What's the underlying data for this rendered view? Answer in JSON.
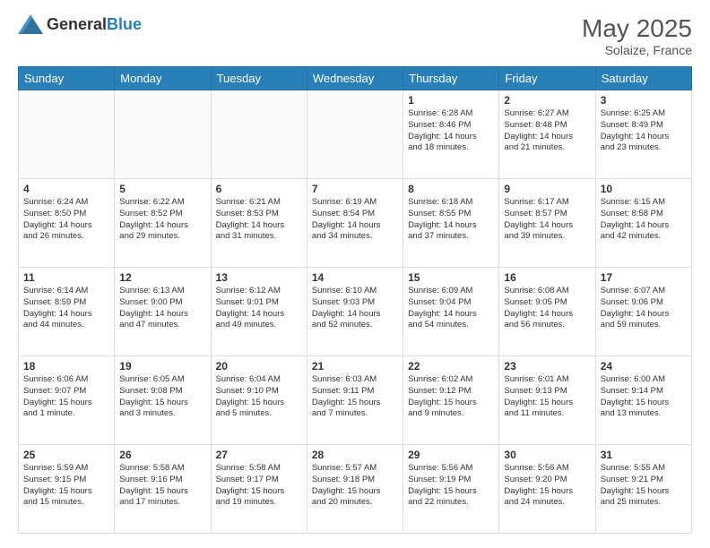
{
  "logo": {
    "text_general": "General",
    "text_blue": "Blue"
  },
  "title": {
    "month_year": "May 2025",
    "location": "Solaize, France"
  },
  "days_of_week": [
    "Sunday",
    "Monday",
    "Tuesday",
    "Wednesday",
    "Thursday",
    "Friday",
    "Saturday"
  ],
  "weeks": [
    {
      "days": [
        {
          "num": "",
          "info": ""
        },
        {
          "num": "",
          "info": ""
        },
        {
          "num": "",
          "info": ""
        },
        {
          "num": "",
          "info": ""
        },
        {
          "num": "1",
          "info": "Sunrise: 6:28 AM\nSunset: 8:46 PM\nDaylight: 14 hours\nand 18 minutes."
        },
        {
          "num": "2",
          "info": "Sunrise: 6:27 AM\nSunset: 8:48 PM\nDaylight: 14 hours\nand 21 minutes."
        },
        {
          "num": "3",
          "info": "Sunrise: 6:25 AM\nSunset: 8:49 PM\nDaylight: 14 hours\nand 23 minutes."
        }
      ]
    },
    {
      "days": [
        {
          "num": "4",
          "info": "Sunrise: 6:24 AM\nSunset: 8:50 PM\nDaylight: 14 hours\nand 26 minutes."
        },
        {
          "num": "5",
          "info": "Sunrise: 6:22 AM\nSunset: 8:52 PM\nDaylight: 14 hours\nand 29 minutes."
        },
        {
          "num": "6",
          "info": "Sunrise: 6:21 AM\nSunset: 8:53 PM\nDaylight: 14 hours\nand 31 minutes."
        },
        {
          "num": "7",
          "info": "Sunrise: 6:19 AM\nSunset: 8:54 PM\nDaylight: 14 hours\nand 34 minutes."
        },
        {
          "num": "8",
          "info": "Sunrise: 6:18 AM\nSunset: 8:55 PM\nDaylight: 14 hours\nand 37 minutes."
        },
        {
          "num": "9",
          "info": "Sunrise: 6:17 AM\nSunset: 8:57 PM\nDaylight: 14 hours\nand 39 minutes."
        },
        {
          "num": "10",
          "info": "Sunrise: 6:15 AM\nSunset: 8:58 PM\nDaylight: 14 hours\nand 42 minutes."
        }
      ]
    },
    {
      "days": [
        {
          "num": "11",
          "info": "Sunrise: 6:14 AM\nSunset: 8:59 PM\nDaylight: 14 hours\nand 44 minutes."
        },
        {
          "num": "12",
          "info": "Sunrise: 6:13 AM\nSunset: 9:00 PM\nDaylight: 14 hours\nand 47 minutes."
        },
        {
          "num": "13",
          "info": "Sunrise: 6:12 AM\nSunset: 9:01 PM\nDaylight: 14 hours\nand 49 minutes."
        },
        {
          "num": "14",
          "info": "Sunrise: 6:10 AM\nSunset: 9:03 PM\nDaylight: 14 hours\nand 52 minutes."
        },
        {
          "num": "15",
          "info": "Sunrise: 6:09 AM\nSunset: 9:04 PM\nDaylight: 14 hours\nand 54 minutes."
        },
        {
          "num": "16",
          "info": "Sunrise: 6:08 AM\nSunset: 9:05 PM\nDaylight: 14 hours\nand 56 minutes."
        },
        {
          "num": "17",
          "info": "Sunrise: 6:07 AM\nSunset: 9:06 PM\nDaylight: 14 hours\nand 59 minutes."
        }
      ]
    },
    {
      "days": [
        {
          "num": "18",
          "info": "Sunrise: 6:06 AM\nSunset: 9:07 PM\nDaylight: 15 hours\nand 1 minute."
        },
        {
          "num": "19",
          "info": "Sunrise: 6:05 AM\nSunset: 9:08 PM\nDaylight: 15 hours\nand 3 minutes."
        },
        {
          "num": "20",
          "info": "Sunrise: 6:04 AM\nSunset: 9:10 PM\nDaylight: 15 hours\nand 5 minutes."
        },
        {
          "num": "21",
          "info": "Sunrise: 6:03 AM\nSunset: 9:11 PM\nDaylight: 15 hours\nand 7 minutes."
        },
        {
          "num": "22",
          "info": "Sunrise: 6:02 AM\nSunset: 9:12 PM\nDaylight: 15 hours\nand 9 minutes."
        },
        {
          "num": "23",
          "info": "Sunrise: 6:01 AM\nSunset: 9:13 PM\nDaylight: 15 hours\nand 11 minutes."
        },
        {
          "num": "24",
          "info": "Sunrise: 6:00 AM\nSunset: 9:14 PM\nDaylight: 15 hours\nand 13 minutes."
        }
      ]
    },
    {
      "days": [
        {
          "num": "25",
          "info": "Sunrise: 5:59 AM\nSunset: 9:15 PM\nDaylight: 15 hours\nand 15 minutes."
        },
        {
          "num": "26",
          "info": "Sunrise: 5:58 AM\nSunset: 9:16 PM\nDaylight: 15 hours\nand 17 minutes."
        },
        {
          "num": "27",
          "info": "Sunrise: 5:58 AM\nSunset: 9:17 PM\nDaylight: 15 hours\nand 19 minutes."
        },
        {
          "num": "28",
          "info": "Sunrise: 5:57 AM\nSunset: 9:18 PM\nDaylight: 15 hours\nand 20 minutes."
        },
        {
          "num": "29",
          "info": "Sunrise: 5:56 AM\nSunset: 9:19 PM\nDaylight: 15 hours\nand 22 minutes."
        },
        {
          "num": "30",
          "info": "Sunrise: 5:56 AM\nSunset: 9:20 PM\nDaylight: 15 hours\nand 24 minutes."
        },
        {
          "num": "31",
          "info": "Sunrise: 5:55 AM\nSunset: 9:21 PM\nDaylight: 15 hours\nand 25 minutes."
        }
      ]
    }
  ]
}
